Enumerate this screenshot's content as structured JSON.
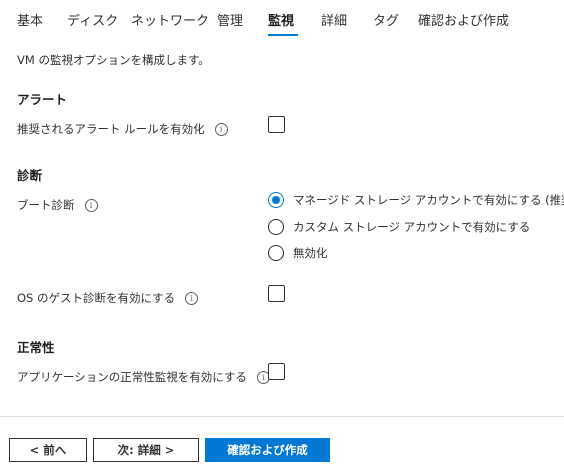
{
  "tabs": [
    {
      "label": "基本"
    },
    {
      "label": "ディスク"
    },
    {
      "label": "ネットワーク"
    },
    {
      "label": "管理"
    },
    {
      "label": "監視"
    },
    {
      "label": "詳細"
    },
    {
      "label": "タグ"
    },
    {
      "label": "確認および作成"
    }
  ],
  "active_tab": "監視",
  "description": "VM の監視オプションを構成します。",
  "alert": {
    "title": "アラート",
    "enable_label": "推奨されるアラート ルールを有効化",
    "checked": false
  },
  "diagnostics": {
    "title": "診断",
    "boot_label": "ブート診断",
    "options": [
      {
        "label": "マネージド ストレージ アカウントで有効にする (推奨)",
        "selected": true
      },
      {
        "label": "カスタム ストレージ アカウントで有効にする",
        "selected": false
      },
      {
        "label": "無効化",
        "selected": false
      }
    ],
    "guest_os_label": "OS のゲスト診断を有効にする",
    "guest_os_checked": false
  },
  "health": {
    "title": "正常性",
    "app_health_label": "アプリケーションの正常性監視を有効にする",
    "checked": false
  },
  "info_glyph": "i",
  "footer": {
    "prev_label": "< 前へ",
    "next_label": "次: 詳細 >",
    "create_label": "確認および作成"
  },
  "colors": {
    "accent": "#0078d4",
    "divider": "#e1dfdd"
  }
}
